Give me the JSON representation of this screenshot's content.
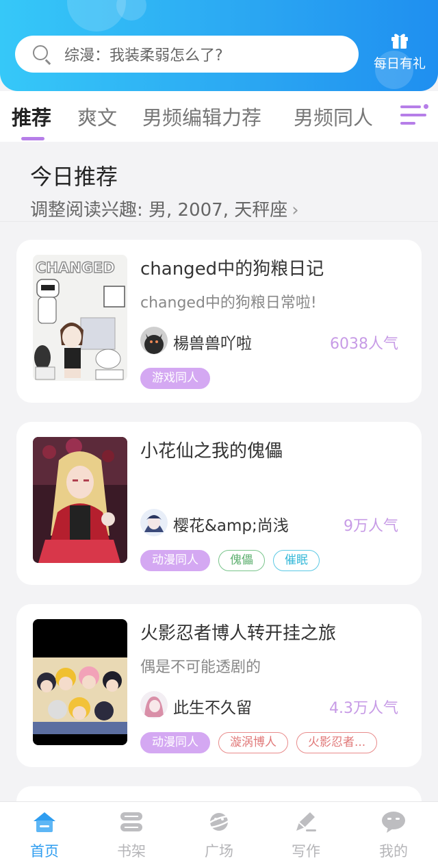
{
  "header": {
    "search_placeholder": "综漫：我装柔弱怎么了?",
    "daily_label": "每日有礼",
    "colors": {
      "gradient_start": "#36c8f8",
      "gradient_end": "#1f8ff0"
    }
  },
  "tabs": [
    {
      "label": "推荐",
      "active": true
    },
    {
      "label": "爽文",
      "active": false
    },
    {
      "label": "男频编辑力荐",
      "active": false
    },
    {
      "label": "男频同人",
      "active": false
    }
  ],
  "section": {
    "title": "今日推荐",
    "preference": "调整阅读兴趣: 男, 2007, 天秤座",
    "chevron": "›"
  },
  "books": [
    {
      "title": "changed中的狗粮日记",
      "description": "changed中的狗粮日常啦!",
      "author": "楊兽兽吖啦",
      "popularity": "6038人气",
      "cover_text": "CHANGED",
      "tags": [
        {
          "label": "游戏同人",
          "style": "purple"
        }
      ]
    },
    {
      "title": "小花仙之我的傀儡",
      "description": "",
      "author": "樱花&amp;尚浅",
      "popularity": "9万人气",
      "tags": [
        {
          "label": "动漫同人",
          "style": "purple"
        },
        {
          "label": "傀儡",
          "style": "green"
        },
        {
          "label": "催眠",
          "style": "cyan"
        }
      ]
    },
    {
      "title": "火影忍者博人转开挂之旅",
      "description": "偶是不可能透剧的",
      "author": "此生不久留",
      "popularity": "4.3万人气",
      "tags": [
        {
          "label": "动漫同人",
          "style": "purple"
        },
        {
          "label": "漩涡博人",
          "style": "red"
        },
        {
          "label": "火影忍者...",
          "style": "red"
        }
      ]
    }
  ],
  "bottom_nav": [
    {
      "label": "首页",
      "icon": "home-icon",
      "active": true
    },
    {
      "label": "书架",
      "icon": "bookshelf-icon",
      "active": false
    },
    {
      "label": "广场",
      "icon": "planet-icon",
      "active": false
    },
    {
      "label": "写作",
      "icon": "pen-icon",
      "active": false
    },
    {
      "label": "我的",
      "icon": "profile-icon",
      "active": false
    }
  ],
  "accent_colors": {
    "purple": "#b67ee8",
    "blue": "#2e9df0",
    "popularity": "#c79be6"
  }
}
